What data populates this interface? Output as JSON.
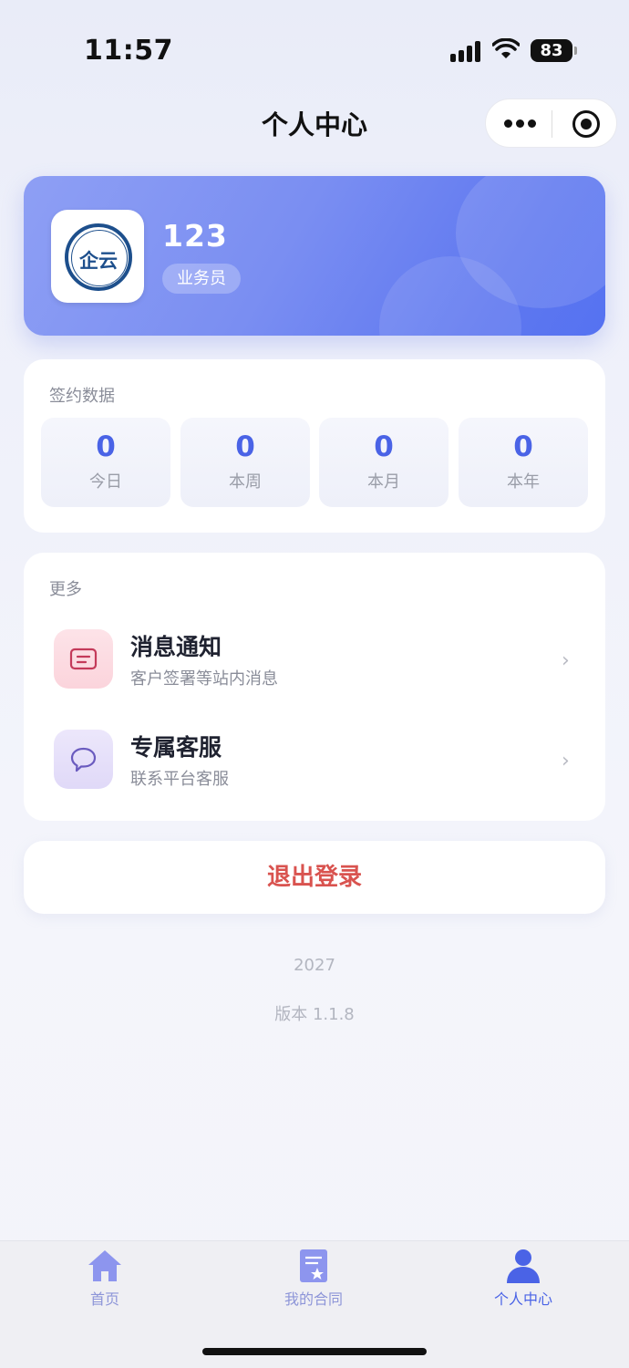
{
  "status_bar": {
    "time": "11:57",
    "battery": "83"
  },
  "nav": {
    "title": "个人中心"
  },
  "profile": {
    "name": "123",
    "role": "业务员",
    "avatar_text": "企云"
  },
  "stats": {
    "title": "签约数据",
    "items": [
      {
        "value": "0",
        "label": "今日"
      },
      {
        "value": "0",
        "label": "本周"
      },
      {
        "value": "0",
        "label": "本月"
      },
      {
        "value": "0",
        "label": "本年"
      }
    ]
  },
  "more": {
    "title": "更多",
    "items": [
      {
        "title": "消息通知",
        "subtitle": "客户签署等站内消息",
        "icon": "message-icon"
      },
      {
        "title": "专属客服",
        "subtitle": "联系平台客服",
        "icon": "chat-bubble-icon"
      }
    ]
  },
  "logout_label": "退出登录",
  "footer": {
    "year": "2027",
    "version": "版本 1.1.8"
  },
  "tabbar": {
    "items": [
      {
        "label": "首页",
        "icon": "home-icon"
      },
      {
        "label": "我的合同",
        "icon": "contract-icon"
      },
      {
        "label": "个人中心",
        "icon": "user-icon",
        "active": true
      }
    ]
  },
  "colors": {
    "accent": "#4a63e6",
    "danger": "#d9534f",
    "card_gradient_start": "#8e9ff4",
    "card_gradient_end": "#5572f1"
  }
}
